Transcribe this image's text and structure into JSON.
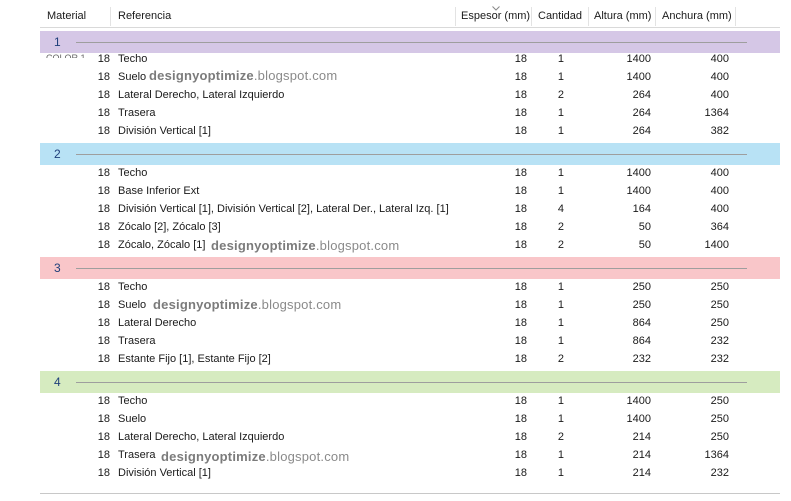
{
  "columns": {
    "material": "Material",
    "referencia": "Referencia",
    "espesor": "Espesor (mm)",
    "cantidad": "Cantidad",
    "altura": "Altura (mm)",
    "anchura": "Anchura (mm)"
  },
  "sort_icon": "chevron-down-icon",
  "color_fragment": "COLOR 1",
  "watermark": {
    "bold": "designyoptimize",
    "rest": ".blogspot.com"
  },
  "groups": [
    {
      "label": "1",
      "color": "#d5c7e6",
      "rows": [
        {
          "material": "18",
          "ref": "Techo",
          "espesor": "18",
          "cantidad": "1",
          "altura": "1400",
          "anchura": "400"
        },
        {
          "material": "18",
          "ref": "Suelo",
          "espesor": "18",
          "cantidad": "1",
          "altura": "1400",
          "anchura": "400"
        },
        {
          "material": "18",
          "ref": "Lateral Derecho, Lateral Izquierdo",
          "espesor": "18",
          "cantidad": "2",
          "altura": "264",
          "anchura": "400"
        },
        {
          "material": "18",
          "ref": "Trasera",
          "espesor": "18",
          "cantidad": "1",
          "altura": "264",
          "anchura": "1364"
        },
        {
          "material": "18",
          "ref": "División Vertical [1]",
          "espesor": "18",
          "cantidad": "1",
          "altura": "264",
          "anchura": "382"
        }
      ]
    },
    {
      "label": "2",
      "color": "#b8e2f5",
      "rows": [
        {
          "material": "18",
          "ref": "Techo",
          "espesor": "18",
          "cantidad": "1",
          "altura": "1400",
          "anchura": "400"
        },
        {
          "material": "18",
          "ref": "Base Inferior Ext",
          "espesor": "18",
          "cantidad": "1",
          "altura": "1400",
          "anchura": "400"
        },
        {
          "material": "18",
          "ref": "División Vertical [1], División Vertical [2], Lateral Der., Lateral Izq. [1]",
          "espesor": "18",
          "cantidad": "4",
          "altura": "164",
          "anchura": "400"
        },
        {
          "material": "18",
          "ref": "Zócalo [2], Zócalo [3]",
          "espesor": "18",
          "cantidad": "2",
          "altura": "50",
          "anchura": "364"
        },
        {
          "material": "18",
          "ref": "Zócalo, Zócalo [1]",
          "espesor": "18",
          "cantidad": "2",
          "altura": "50",
          "anchura": "1400"
        }
      ]
    },
    {
      "label": "3",
      "color": "#f9c6c9",
      "rows": [
        {
          "material": "18",
          "ref": "Techo",
          "espesor": "18",
          "cantidad": "1",
          "altura": "250",
          "anchura": "250"
        },
        {
          "material": "18",
          "ref": "Suelo",
          "espesor": "18",
          "cantidad": "1",
          "altura": "250",
          "anchura": "250"
        },
        {
          "material": "18",
          "ref": "Lateral Derecho",
          "espesor": "18",
          "cantidad": "1",
          "altura": "864",
          "anchura": "250"
        },
        {
          "material": "18",
          "ref": "Trasera",
          "espesor": "18",
          "cantidad": "1",
          "altura": "864",
          "anchura": "232"
        },
        {
          "material": "18",
          "ref": "Estante Fijo [1], Estante Fijo [2]",
          "espesor": "18",
          "cantidad": "2",
          "altura": "232",
          "anchura": "232"
        }
      ]
    },
    {
      "label": "4",
      "color": "#d6ebc0",
      "rows": [
        {
          "material": "18",
          "ref": "Techo",
          "espesor": "18",
          "cantidad": "1",
          "altura": "1400",
          "anchura": "250"
        },
        {
          "material": "18",
          "ref": "Suelo",
          "espesor": "18",
          "cantidad": "1",
          "altura": "1400",
          "anchura": "250"
        },
        {
          "material": "18",
          "ref": "Lateral Derecho, Lateral Izquierdo",
          "espesor": "18",
          "cantidad": "2",
          "altura": "214",
          "anchura": "250"
        },
        {
          "material": "18",
          "ref": "Trasera",
          "espesor": "18",
          "cantidad": "1",
          "altura": "214",
          "anchura": "1364"
        },
        {
          "material": "18",
          "ref": "División Vertical [1]",
          "espesor": "18",
          "cantidad": "1",
          "altura": "214",
          "anchura": "232"
        }
      ]
    }
  ]
}
